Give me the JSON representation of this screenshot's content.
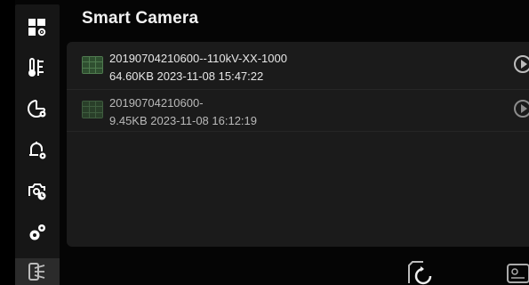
{
  "header": {
    "title": "Smart Camera"
  },
  "sidebar": {
    "items": [
      {
        "icon": "dashboard-settings-icon"
      },
      {
        "icon": "thermometer-icon"
      },
      {
        "icon": "chart-settings-icon"
      },
      {
        "icon": "alarm-settings-icon"
      },
      {
        "icon": "camera-timer-icon"
      },
      {
        "icon": "gears-icon"
      },
      {
        "icon": "recordings-icon",
        "active": true
      }
    ]
  },
  "files": [
    {
      "name": "20190704210600--110kV-XX-1000",
      "size": "64.60KB",
      "datetime": "2023-11-08 15:47:22",
      "meta": "64.60KB 2023-11-08 15:47:22"
    },
    {
      "name": "20190704210600-",
      "size": "9.45KB",
      "datetime": "2023-11-08 16:12:19",
      "meta": "9.45KB 2023-11-08 16:12:19"
    }
  ],
  "bottom_bar": {
    "icons": [
      "refresh-folder-icon",
      "device-info-icon"
    ]
  },
  "colors": {
    "background": "#050505",
    "sidebar": "#161616",
    "panel": "#1b1b1b",
    "thumbnail": "#4f7a4f"
  }
}
